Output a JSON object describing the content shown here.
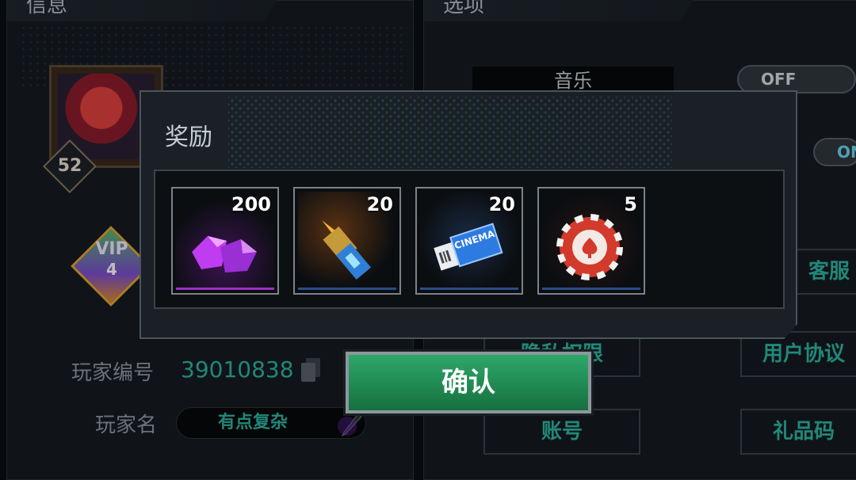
{
  "background": {
    "left_panel": {
      "header": "信息",
      "level": "52",
      "vip_label": "VIP",
      "vip_level": "4",
      "player_id_label": "玩家编号",
      "player_id": "39010838",
      "player_name_label": "玩家名",
      "player_name": "有点复杂"
    },
    "right_panel": {
      "header": "选项",
      "music_label": "音乐",
      "music_toggle": "OFF",
      "second_toggle": "ON",
      "buttons": {
        "customer_service": "客服",
        "privacy": "隐私权限",
        "user_agreement": "用户协议",
        "account": "账号",
        "gift_code": "礼品码"
      }
    }
  },
  "modal": {
    "title": "奖励",
    "rewards": [
      {
        "name": "purple-gem-icon",
        "count": "200",
        "accent": "#9b2fc4"
      },
      {
        "name": "bullet-icon",
        "count": "20",
        "accent": "#2a4d8a"
      },
      {
        "name": "cinema-ticket-icon",
        "count": "20",
        "accent": "#2a4d8a",
        "ticket_text": "CINEMA"
      },
      {
        "name": "poker-chip-icon",
        "count": "5",
        "accent": "#2a4d8a"
      }
    ],
    "confirm_label": "确认"
  }
}
